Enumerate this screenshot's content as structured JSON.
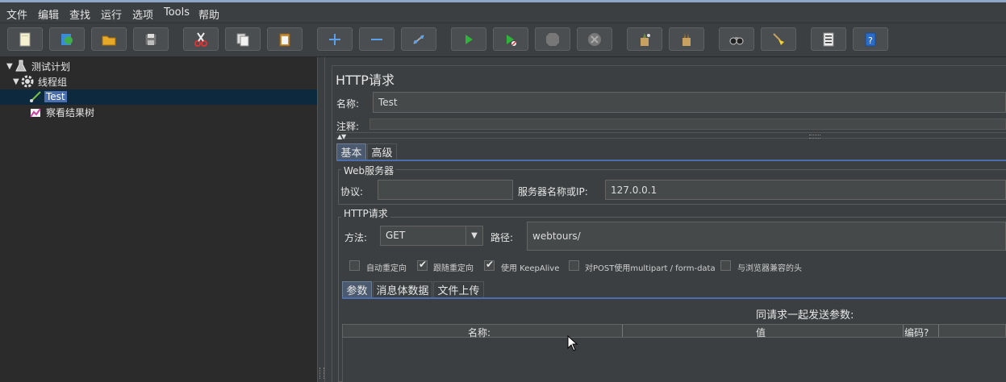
{
  "menu": [
    "文件",
    "编辑",
    "查找",
    "运行",
    "选项",
    "Tools",
    "帮助"
  ],
  "toolbar": {
    "buttons": [
      "new-icon",
      "templates-icon",
      "open-icon",
      "save-icon",
      "cut-icon",
      "copy-icon",
      "paste-icon",
      "expand-icon",
      "collapse-icon",
      "toggle-icon",
      "start-icon",
      "start-no-pause-icon",
      "stop-icon",
      "shutdown-icon",
      "clear-icon",
      "clear-all-icon",
      "search-icon",
      "reset-search-icon",
      "function-helper-icon",
      "help-icon"
    ]
  },
  "tree": {
    "items": [
      {
        "label": "测试计划",
        "icon": "test-plan-icon",
        "level": 0,
        "expanded": true
      },
      {
        "label": "线程组",
        "icon": "thread-group-icon",
        "level": 1,
        "expanded": true
      },
      {
        "label": "Test",
        "icon": "http-sampler-icon",
        "level": 2,
        "selected": true
      },
      {
        "label": "察看结果树",
        "icon": "result-tree-icon",
        "level": 2
      }
    ]
  },
  "panel": {
    "title": "HTTP请求",
    "name_label": "名称:",
    "name_value": "Test",
    "comment_label": "注释:",
    "tabs": [
      "基本",
      "高级"
    ],
    "web_server": {
      "title": "Web服务器",
      "protocol_label": "协议:",
      "protocol_value": "",
      "server_label": "服务器名称或IP:",
      "server_value": "127.0.0.1"
    },
    "http_request": {
      "title": "HTTP请求",
      "method_label": "方法:",
      "method_value": "GET",
      "path_label": "路径:",
      "path_value": "webtours/"
    },
    "checkboxes": [
      {
        "label": "自动重定向",
        "checked": false
      },
      {
        "label": "跟随重定向",
        "checked": true
      },
      {
        "label": "使用 KeepAlive",
        "checked": true
      },
      {
        "label": "对POST使用multipart / form-data",
        "checked": false
      },
      {
        "label": "与浏览器兼容的头",
        "checked": false
      }
    ],
    "sub_tabs": [
      "参数",
      "消息体数据",
      "文件上传"
    ],
    "params_title": "同请求一起发送参数:",
    "table_headers": [
      "名称:",
      "值",
      "编码?"
    ]
  }
}
